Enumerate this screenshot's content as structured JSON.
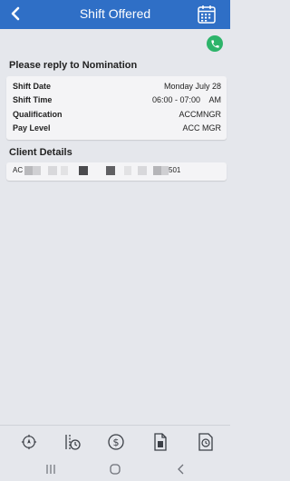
{
  "header": {
    "title": "Shift Offered"
  },
  "nomination": {
    "heading": "Please reply to Nomination",
    "rows": [
      {
        "label": "Shift Date",
        "value": "Monday July 28"
      },
      {
        "label": "Shift Time",
        "value": "06:00 - 07:00    AM"
      },
      {
        "label": "Qualification",
        "value": "ACCMNGR"
      },
      {
        "label": "Pay Level",
        "value": "ACC MGR"
      }
    ]
  },
  "client": {
    "heading": "Client Details",
    "prefix": "AC",
    "suffix": "501"
  },
  "colors": {
    "header": "#2f6fc6",
    "phone": "#2db46a",
    "icon": "#3b3f46"
  },
  "icons": {
    "back": "chevron-left-icon",
    "calendar": "calendar-icon",
    "phone": "phone-icon",
    "nav": [
      "compass-icon",
      "timeline-clock-icon",
      "dollar-icon",
      "document-icon",
      "document-clock-icon"
    ]
  }
}
